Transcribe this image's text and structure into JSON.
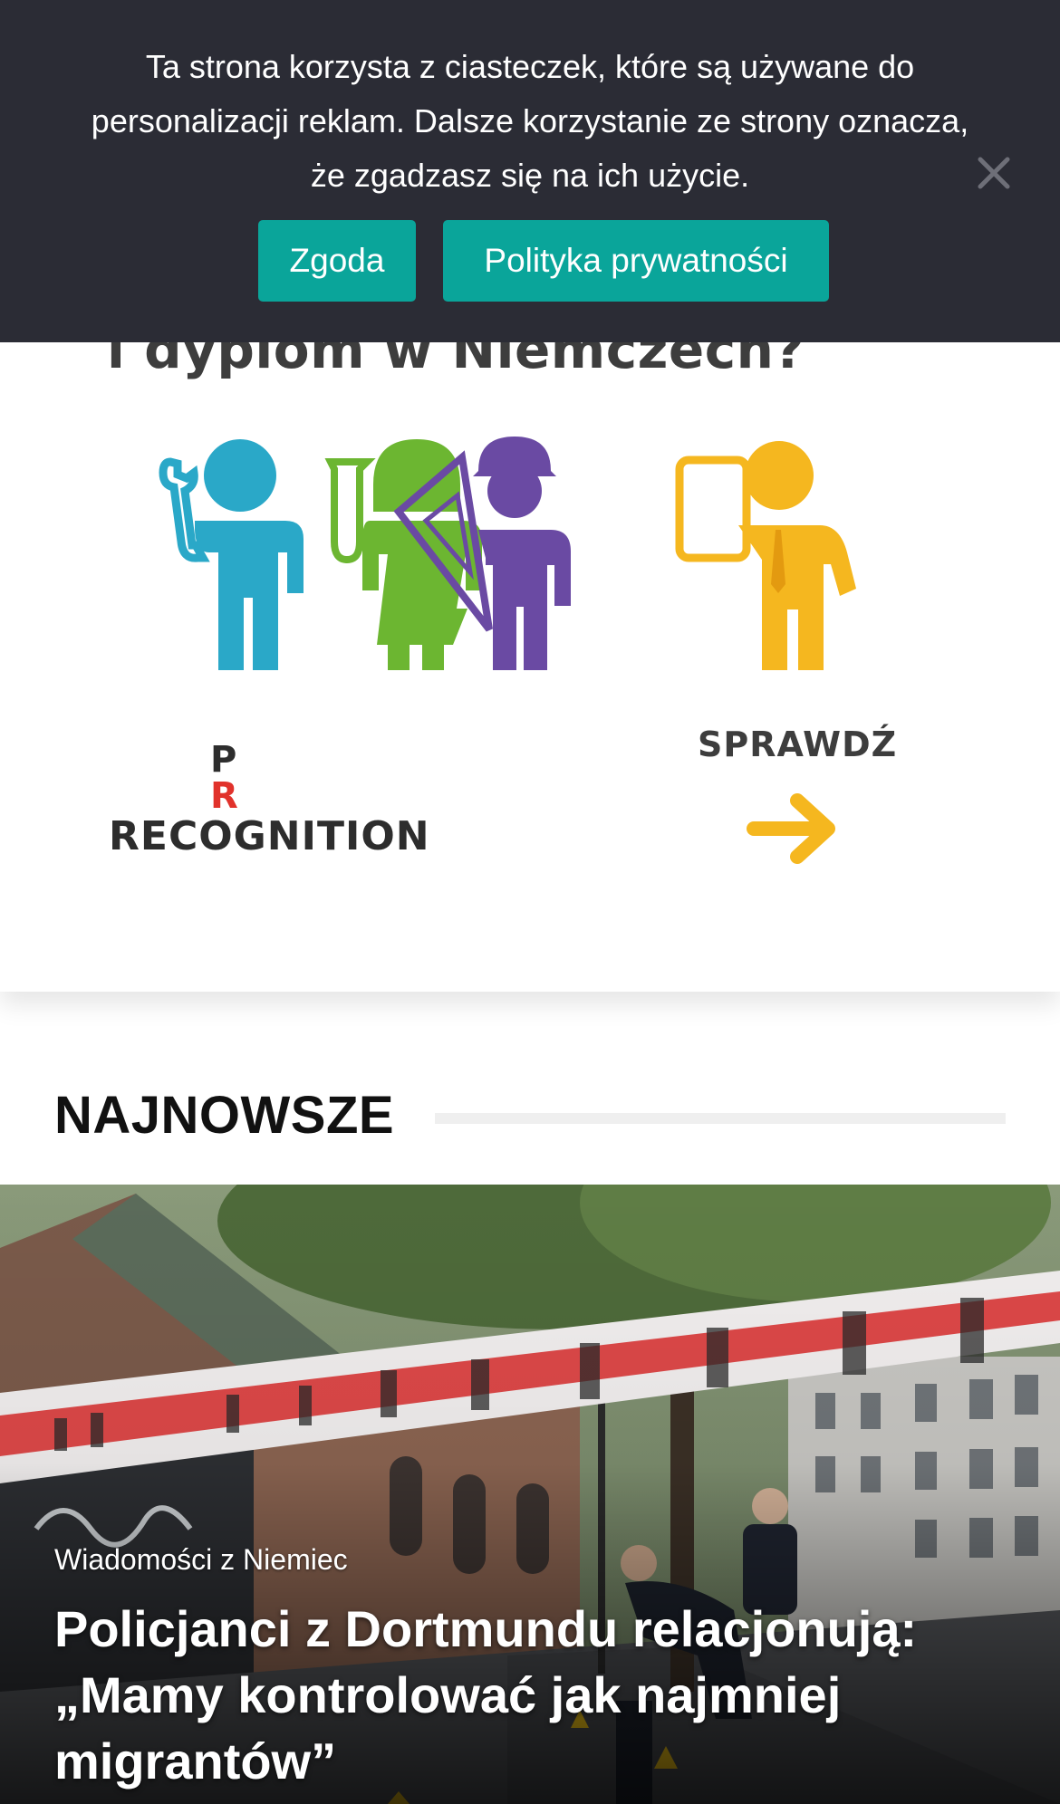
{
  "cookie_notice": {
    "message": "Ta strona korzysta z ciasteczek, które są używane do personalizacji reklam. Dalsze korzystanie ze strony oznacza, że zgadzasz się na ich użycie.",
    "accept_label": "Zgoda",
    "privacy_label": "Polityka prywatności",
    "close_icon": "close-icon",
    "background_color": "#2b2c35",
    "button_color": "#0aa59a"
  },
  "ad_banner": {
    "heading": "i dyplom w Niemczech?",
    "logo_text": "RECOGNITION",
    "logo_letters": [
      "P",
      "R"
    ],
    "cta_label": "SPRAWDŹ",
    "cta_icon": "arrow-right-icon",
    "figure_icons": [
      "wrench-person-icon",
      "test-tube-person-icon",
      "hardhat-ruler-person-icon",
      "tablet-person-icon"
    ],
    "figure_colors": [
      "#2aa8c8",
      "#6cb631",
      "#6a4aa3",
      "#f5b71f"
    ]
  },
  "section": {
    "title": "NAJNOWSZE"
  },
  "featured_article": {
    "category": "Wiadomości z Niemiec",
    "title": "Policjanci z Dortmundu relacjonują: „Mamy kontrolować jak najmniej migrantów”",
    "image_alt": "police-tape-street-photo"
  }
}
